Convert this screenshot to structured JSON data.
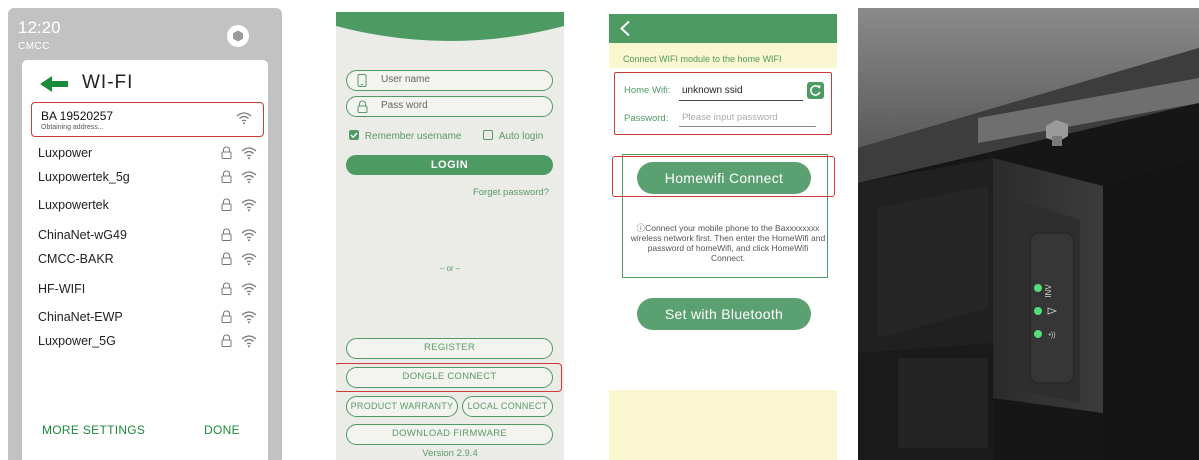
{
  "wifi_screen": {
    "time": "12:20",
    "carrier": "CMCC",
    "title": "WI-FI",
    "connected": {
      "name": "BA 19520257",
      "status": "Obtaining address..."
    },
    "networks": [
      "Luxpower",
      "Luxpowertek_5g",
      "Luxpowertek",
      "ChinaNet-wG49",
      "CMCC-BAKR",
      "HF-WIFI",
      "ChinaNet-EWP",
      "Luxpower_5G"
    ],
    "more_settings": "MORE SETTINGS",
    "done": "DONE"
  },
  "login_screen": {
    "username_placeholder": "User name",
    "password_placeholder": "Pass word",
    "remember_username": "Remember username",
    "remember_checked": true,
    "auto_login": "Auto login",
    "auto_login_checked": false,
    "login": "LOGIN",
    "forget_password": "Forget password?",
    "or": "– or –",
    "register": "REGISTER",
    "dongle_connect": "DONGLE CONNECT",
    "product_warranty": "PRODUCT WARRANTY",
    "local_connect": "LOCAL CONNECT",
    "download_firmware": "DOWNLOAD FIRMWARE",
    "version": "Version 2.9.4"
  },
  "connect_screen": {
    "banner": "Connect WIFI module to the home WIFI",
    "home_wifi_label": "Home Wifi:",
    "home_wifi_value": "unknown ssid",
    "password_label": "Password:",
    "password_placeholder": "Please input password",
    "homewifi_connect": "Homewifi Connect",
    "info": "Connect your mobile phone to the Baxxxxxxxx wireless network first. Then enter the HomeWifi and password of homeWifi, and click HomeWifi Connect.",
    "set_bluetooth": "Set with Bluetooth"
  },
  "device_photo": {
    "led_labels": [
      "INV",
      "",
      ""
    ]
  },
  "colors": {
    "brand_green": "#4e9a63",
    "highlight_red": "#cc3a3a",
    "banner_yellow": "#fbf6d2"
  },
  "icons": [
    "back-arrow-icon",
    "wifi-icon",
    "lock-icon",
    "phone-icon",
    "lock-outline-icon",
    "checkbox-icon",
    "chevron-left-icon",
    "refresh-icon",
    "info-icon",
    "hexagon-icon"
  ]
}
